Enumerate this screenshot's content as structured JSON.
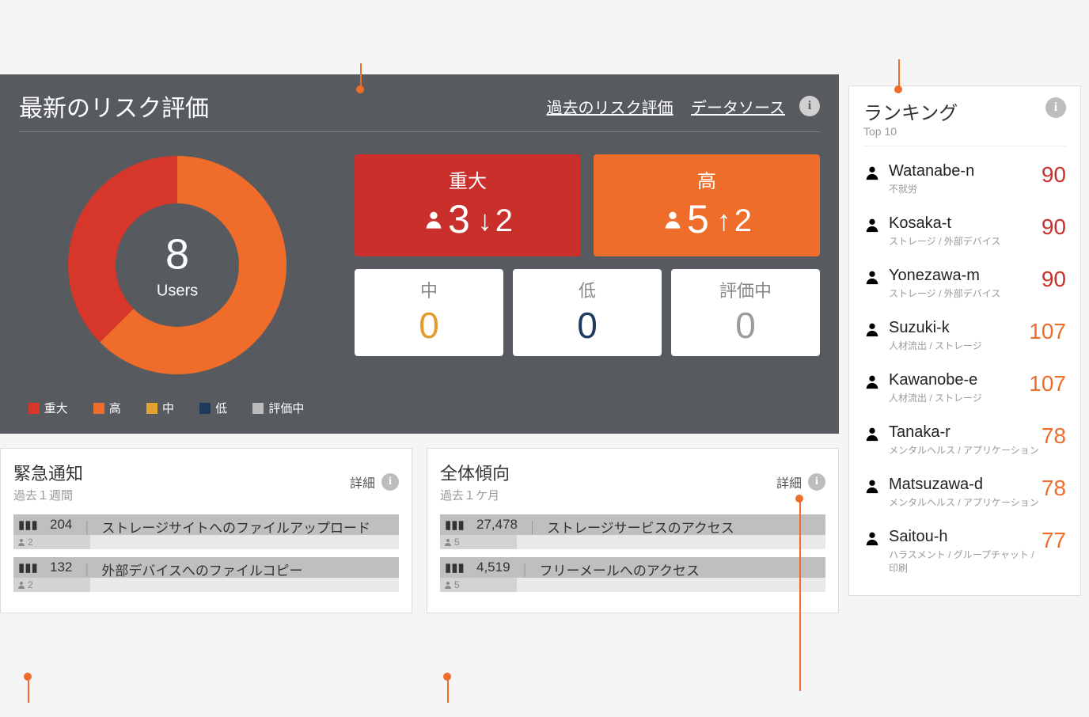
{
  "riskPanel": {
    "title": "最新のリスク評価",
    "linkPast": "過去のリスク評価",
    "linkSource": "データソース",
    "totalUsers": "8",
    "usersLabel": "Users",
    "legend": {
      "critical": "重大",
      "high": "高",
      "medium": "中",
      "low": "低",
      "evaluating": "評価中"
    },
    "cards": {
      "critical": {
        "label": "重大",
        "count": "3",
        "deltaDir": "↓",
        "delta": "2"
      },
      "high": {
        "label": "高",
        "count": "5",
        "deltaDir": "↑",
        "delta": "2"
      },
      "medium": {
        "label": "中",
        "value": "0"
      },
      "low": {
        "label": "低",
        "value": "0"
      },
      "evaluating": {
        "label": "評価中",
        "value": "0"
      }
    }
  },
  "urgent": {
    "title": "緊急通知",
    "subtitle": "過去１週間",
    "detail": "詳細",
    "rows": [
      {
        "count": "204",
        "label": "ストレージサイトへのファイルアップロード",
        "sub": "2"
      },
      {
        "count": "132",
        "label": "外部デバイスへのファイルコピー",
        "sub": "2"
      }
    ]
  },
  "trend": {
    "title": "全体傾向",
    "subtitle": "過去１ケ月",
    "detail": "詳細",
    "rows": [
      {
        "count": "27,478",
        "label": "ストレージサービスのアクセス",
        "sub": "5"
      },
      {
        "count": "4,519",
        "label": "フリーメールへのアクセス",
        "sub": "5"
      }
    ]
  },
  "ranking": {
    "title": "ランキング",
    "subtitle": "Top 10",
    "items": [
      {
        "name": "Watanabe-n",
        "cat": "不就労",
        "score": "90",
        "cls": "score-90"
      },
      {
        "name": "Kosaka-t",
        "cat": "ストレージ / 外部デバイス",
        "score": "90",
        "cls": "score-90"
      },
      {
        "name": "Yonezawa-m",
        "cat": "ストレージ / 外部デバイス",
        "score": "90",
        "cls": "score-90"
      },
      {
        "name": "Suzuki-k",
        "cat": "人材流出 / ストレージ",
        "score": "107",
        "cls": "score-107"
      },
      {
        "name": "Kawanobe-e",
        "cat": "人材流出 / ストレージ",
        "score": "107",
        "cls": "score-107"
      },
      {
        "name": "Tanaka-r",
        "cat": "メンタルヘルス / アプリケーション",
        "score": "78",
        "cls": "score-78"
      },
      {
        "name": "Matsuzawa-d",
        "cat": "メンタルヘルス / アプリケーション",
        "score": "78",
        "cls": "score-78"
      },
      {
        "name": "Saitou-h",
        "cat": "ハラスメント / グループチャット / 印刷",
        "score": "77",
        "cls": "score-77"
      }
    ]
  },
  "chart_data": {
    "type": "pie",
    "title": "最新のリスク評価",
    "categories": [
      "重大",
      "高",
      "中",
      "低",
      "評価中"
    ],
    "values": [
      3,
      5,
      0,
      0,
      0
    ],
    "colors": [
      "#d7362a",
      "#f06c2a",
      "#e0a32e",
      "#1f3a5f",
      "#bcbcbc"
    ],
    "center_label": "8 Users"
  }
}
